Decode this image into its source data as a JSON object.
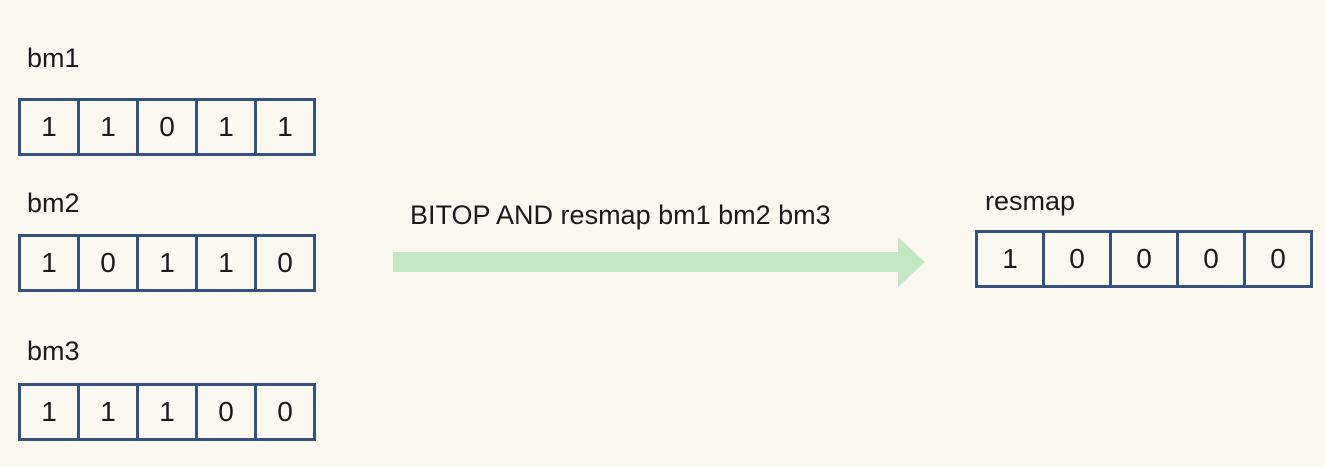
{
  "bitmaps": [
    {
      "name": "bm1",
      "bits": [
        "1",
        "1",
        "0",
        "1",
        "1"
      ]
    },
    {
      "name": "bm2",
      "bits": [
        "1",
        "0",
        "1",
        "1",
        "0"
      ]
    },
    {
      "name": "bm3",
      "bits": [
        "1",
        "1",
        "1",
        "0",
        "0"
      ]
    }
  ],
  "operation": {
    "command": "BITOP AND resmap bm1 bm2 bm3",
    "arrow_color": "#c2e7c2"
  },
  "result": {
    "name": "resmap",
    "bits": [
      "1",
      "0",
      "0",
      "0",
      "0"
    ]
  },
  "colors": {
    "background": "#fbf8ef",
    "cell_border": "#34527f"
  }
}
